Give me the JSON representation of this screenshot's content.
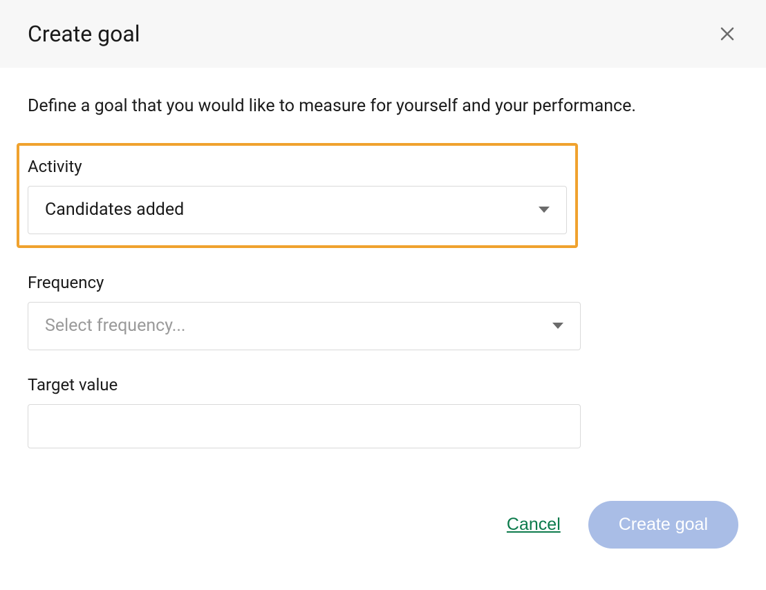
{
  "header": {
    "title": "Create goal"
  },
  "description": "Define a goal that you would like to measure for yourself and your performance.",
  "fields": {
    "activity": {
      "label": "Activity",
      "value": "Candidates added"
    },
    "frequency": {
      "label": "Frequency",
      "placeholder": "Select frequency..."
    },
    "target": {
      "label": "Target value",
      "value": ""
    }
  },
  "footer": {
    "cancel": "Cancel",
    "submit": "Create goal"
  }
}
